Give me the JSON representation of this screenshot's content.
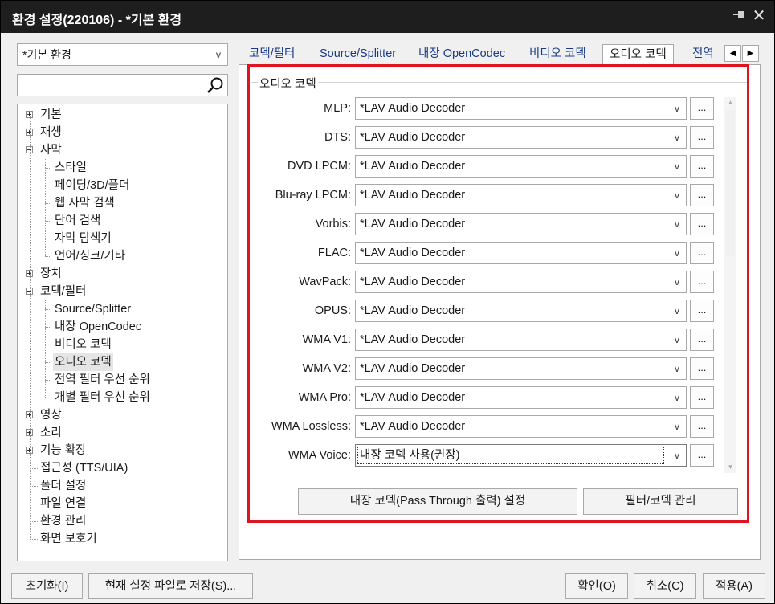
{
  "window": {
    "title": "환경 설정(220106) - *기본 환경",
    "pin_icon": "pin-icon",
    "close_icon": "close-icon"
  },
  "left": {
    "profile_value": "*기본 환경",
    "search_placeholder": "",
    "tree": [
      {
        "label": "기본",
        "level": 0,
        "expander": "plus"
      },
      {
        "label": "재생",
        "level": 0,
        "expander": "plus"
      },
      {
        "label": "자막",
        "level": 0,
        "expander": "minus"
      },
      {
        "label": "스타일",
        "level": 1
      },
      {
        "label": "페이딩/3D/플더",
        "level": 1
      },
      {
        "label": "웹 자막 검색",
        "level": 1
      },
      {
        "label": "단어 검색",
        "level": 1
      },
      {
        "label": "자막 탐색기",
        "level": 1
      },
      {
        "label": "언어/싱크/기타",
        "level": 1
      },
      {
        "label": "장치",
        "level": 0,
        "expander": "plus"
      },
      {
        "label": "코덱/필터",
        "level": 0,
        "expander": "minus"
      },
      {
        "label": "Source/Splitter",
        "level": 1
      },
      {
        "label": "내장 OpenCodec",
        "level": 1
      },
      {
        "label": "비디오 코덱",
        "level": 1
      },
      {
        "label": "오디오 코덱",
        "level": 1,
        "selected": true
      },
      {
        "label": "전역 필터 우선 순위",
        "level": 1
      },
      {
        "label": "개별 필터 우선 순위",
        "level": 1
      },
      {
        "label": "영상",
        "level": 0,
        "expander": "plus"
      },
      {
        "label": "소리",
        "level": 0,
        "expander": "plus"
      },
      {
        "label": "기능 확장",
        "level": 0,
        "expander": "plus"
      },
      {
        "label": "접근성 (TTS/UIA)",
        "level": 0
      },
      {
        "label": "폴더 설정",
        "level": 0
      },
      {
        "label": "파일 연결",
        "level": 0
      },
      {
        "label": "환경 관리",
        "level": 0
      },
      {
        "label": "화면 보호기",
        "level": 0
      }
    ]
  },
  "tabs": [
    {
      "label": "코덱/필터"
    },
    {
      "label": "Source/Splitter"
    },
    {
      "label": "내장 OpenCodec"
    },
    {
      "label": "비디오 코덱"
    },
    {
      "label": "오디오 코덱",
      "active": true
    },
    {
      "label": "전역"
    }
  ],
  "tab_scroll": {
    "left": "◀",
    "right": "▶"
  },
  "group": {
    "title": "오디오 코덱",
    "rows": [
      {
        "label": "MLP:",
        "value": "*LAV Audio Decoder"
      },
      {
        "label": "DTS:",
        "value": "*LAV Audio Decoder"
      },
      {
        "label": "DVD LPCM:",
        "value": "*LAV Audio Decoder"
      },
      {
        "label": "Blu-ray LPCM:",
        "value": "*LAV Audio Decoder"
      },
      {
        "label": "Vorbis:",
        "value": "*LAV Audio Decoder"
      },
      {
        "label": "FLAC:",
        "value": "*LAV Audio Decoder"
      },
      {
        "label": "WavPack:",
        "value": "*LAV Audio Decoder"
      },
      {
        "label": "OPUS:",
        "value": "*LAV Audio Decoder"
      },
      {
        "label": "WMA V1:",
        "value": "*LAV Audio Decoder"
      },
      {
        "label": "WMA V2:",
        "value": "*LAV Audio Decoder"
      },
      {
        "label": "WMA Pro:",
        "value": "*LAV Audio Decoder"
      },
      {
        "label": "WMA Lossless:",
        "value": "*LAV Audio Decoder"
      },
      {
        "label": "WMA Voice:",
        "value": "내장 코덱 사용(권장)",
        "focused": true
      }
    ],
    "dropdown_glyph": "v",
    "more_label": "...",
    "passthrough_button": "내장 코덱(Pass Through 출력) 설정",
    "filter_button": "필터/코덱 관리"
  },
  "footer": {
    "reset": "초기화(I)",
    "save_file": "현재 설정 파일로 저장(S)...",
    "ok": "확인(O)",
    "cancel": "취소(C)",
    "apply": "적용(A)"
  },
  "colors": {
    "highlight_border": "#e0141e",
    "titlebar": "#1e1e1e"
  }
}
